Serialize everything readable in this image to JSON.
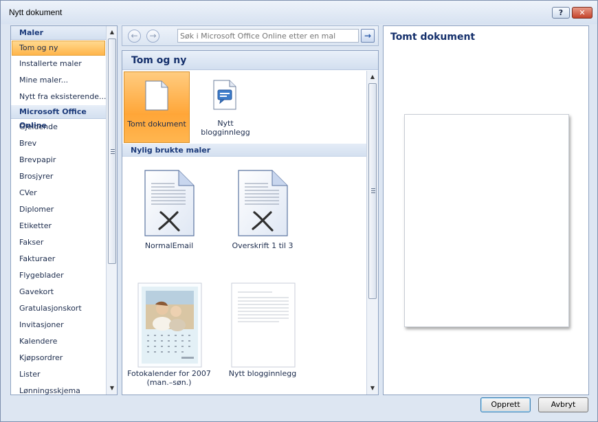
{
  "window": {
    "title": "Nytt dokument",
    "help_label": "?",
    "close_label": "✕"
  },
  "sidebar": {
    "sections": [
      {
        "header": "Maler",
        "items": [
          "Tom og ny",
          "Installerte maler",
          "Mine maler...",
          "Nytt fra eksisterende..."
        ]
      },
      {
        "header": "Microsoft Office Online",
        "items": [
          "Gjeldende",
          "Brev",
          "Brevpapir",
          "Brosjyrer",
          "CVer",
          "Diplomer",
          "Etiketter",
          "Fakser",
          "Fakturaer",
          "Flygeblader",
          "Gavekort",
          "Gratulasjonskort",
          "Invitasjoner",
          "Kalendere",
          "Kjøpsordrer",
          "Lister",
          "Lønningsskjema"
        ]
      }
    ],
    "selected": "Tom og ny"
  },
  "search": {
    "back_label": "←",
    "forward_label": "→",
    "placeholder": "Søk i Microsoft Office Online etter en mal",
    "go_label": "→"
  },
  "main": {
    "header": "Tom og ny",
    "top_tiles": [
      {
        "label": "Tomt dokument",
        "icon": "blank-document-icon",
        "selected": true
      },
      {
        "label": "Nytt blogginnlegg",
        "label_lines": [
          "Nytt",
          "blogginnlegg"
        ],
        "icon": "blog-post-icon",
        "selected": false
      }
    ],
    "recent_header": "Nylig brukte maler",
    "recent_tiles": [
      {
        "label": "NormalEmail",
        "icon": "missing-template-icon"
      },
      {
        "label": "Overskrift 1 til 3",
        "icon": "missing-template-icon"
      },
      {
        "label": "Fotokalender for 2007 (man.–søn.)",
        "label_lines": [
          "Fotokalender for 2007",
          "(man.–søn.)"
        ],
        "icon": "photo-calendar-thumbnail"
      },
      {
        "label": "Nytt blogginnlegg",
        "icon": "blog-page-thumbnail"
      }
    ]
  },
  "preview": {
    "title": "Tomt dokument"
  },
  "buttons": {
    "create": "Opprett",
    "cancel": "Avbryt"
  },
  "colors": {
    "selection": "#ffb54a",
    "header_text": "#142f6b",
    "panel_border": "#8ea2c1"
  }
}
